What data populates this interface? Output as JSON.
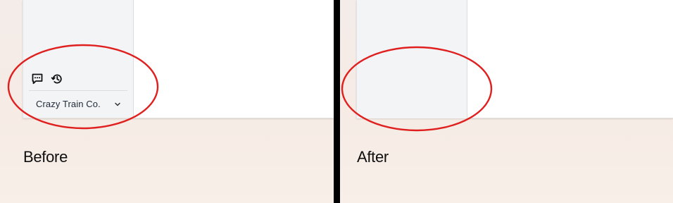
{
  "before": {
    "caption": "Before",
    "org_name": "Crazy Train Co.",
    "icons": [
      "feedback-icon",
      "history-icon",
      "chevron-down-icon"
    ]
  },
  "after": {
    "caption": "After"
  },
  "colors": {
    "highlight_ring": "#e0201f",
    "divider": "#000000",
    "sidebar": "#f3f4f6"
  }
}
